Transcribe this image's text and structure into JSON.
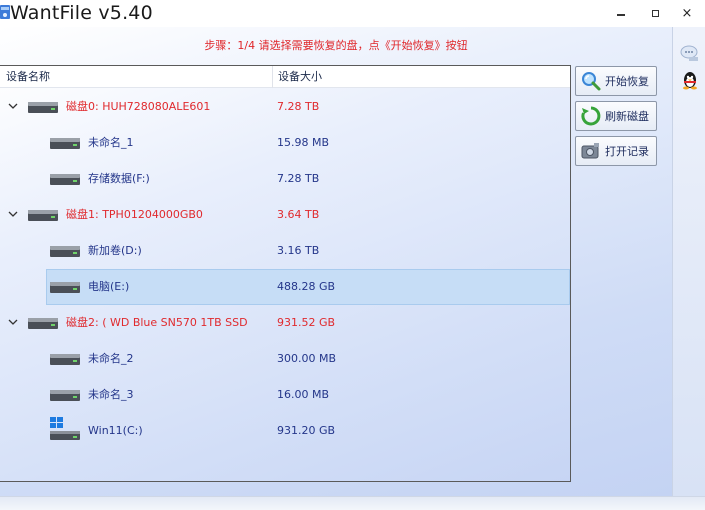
{
  "window": {
    "title": "WantFile v5.40",
    "minimize_label": "",
    "maximize_label": "",
    "close_label": "×"
  },
  "step_text": "步骤：1/4 请选择需要恢复的盘，点《开始恢复》按钮",
  "columns": {
    "name": "设备名称",
    "size": "设备大小"
  },
  "rows": [
    {
      "name": "磁盘0: HUH728080ALE601",
      "size": "7.28 TB",
      "level": 0,
      "color": "red",
      "icon": "hard-disk-icon",
      "expanded": true
    },
    {
      "name": "未命名_1",
      "size": "15.98 MB",
      "level": 1,
      "color": "blue",
      "icon": "partition-icon"
    },
    {
      "name": "存储数据(F:)",
      "size": "7.28 TB",
      "level": 1,
      "color": "blue",
      "icon": "partition-icon"
    },
    {
      "name": "磁盘1: TPH01204000GB0",
      "size": "3.64 TB",
      "level": 0,
      "color": "red",
      "icon": "hard-disk-icon",
      "expanded": true
    },
    {
      "name": "新加卷(D:)",
      "size": "3.16 TB",
      "level": 1,
      "color": "blue",
      "icon": "partition-icon"
    },
    {
      "name": "电脑(E:)",
      "size": "488.28 GB",
      "level": 1,
      "color": "blue",
      "icon": "partition-icon",
      "selected": true
    },
    {
      "name": "磁盘2: ( WD Blue SN570 1TB SSD",
      "size": "931.52 GB",
      "level": 0,
      "color": "red",
      "icon": "hard-disk-icon",
      "expanded": true
    },
    {
      "name": "未命名_2",
      "size": "300.00 MB",
      "level": 1,
      "color": "blue",
      "icon": "partition-icon"
    },
    {
      "name": "未命名_3",
      "size": "16.00 MB",
      "level": 1,
      "color": "blue",
      "icon": "partition-icon"
    },
    {
      "name": "Win11(C:)",
      "size": "931.20 GB",
      "level": 1,
      "color": "blue",
      "icon": "windows-partition-icon"
    }
  ],
  "buttons": {
    "start_recovery": "开始恢复",
    "refresh_disk": "刷新磁盘",
    "open_record": "打开记录"
  },
  "colors": {
    "red_text": "#e02a2e",
    "blue_text": "#24368a",
    "selection": "#c6ddf6"
  }
}
